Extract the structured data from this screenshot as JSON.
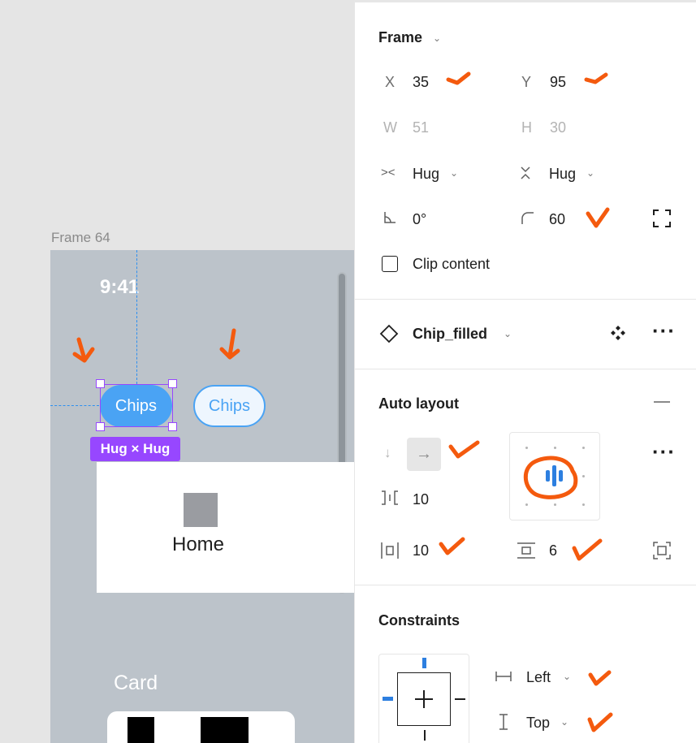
{
  "canvas": {
    "frame_label": "Frame 64",
    "status_time": "9:41",
    "chip_filled_text": "Chips",
    "chip_outline_text": "Chips",
    "selection_badge": "Hug × Hug",
    "home_label": "Home",
    "card_label": "Card"
  },
  "frame_section": {
    "title": "Frame",
    "x_label": "X",
    "x_value": "35",
    "y_label": "Y",
    "y_value": "95",
    "w_label": "W",
    "w_value": "51",
    "h_label": "H",
    "h_value": "30",
    "width_resizing": "Hug",
    "height_resizing": "Hug",
    "rotation": "0°",
    "corner_radius": "60",
    "clip_content_label": "Clip content",
    "clip_content_checked": false
  },
  "component": {
    "name": "Chip_filled"
  },
  "auto_layout": {
    "title": "Auto layout",
    "direction": "horizontal",
    "gap": "10",
    "horizontal_padding": "10",
    "vertical_padding": "6",
    "alignment": "center"
  },
  "constraints": {
    "title": "Constraints",
    "horizontal": "Left",
    "vertical": "Top"
  },
  "colors": {
    "selection": "#9747ff",
    "chip_blue": "#4aa3f4",
    "annotation_orange": "#f45a0e",
    "frame_bg": "#bcc3ca"
  }
}
